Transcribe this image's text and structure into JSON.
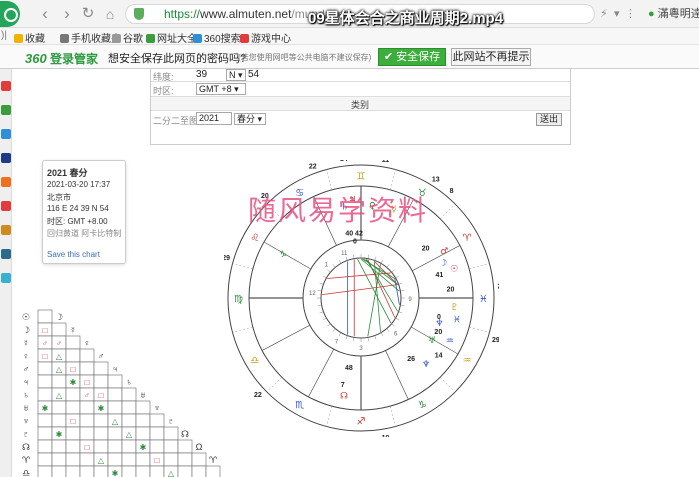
{
  "browser": {
    "url_proto": "https://",
    "url_domain": "www.almuten.net",
    "url_rest": "/mundane",
    "video_title": "09星体会合之商业周期2.mp4",
    "user_label": "滿粵明逹"
  },
  "bookmarks": [
    {
      "label": "收藏",
      "color": "#f0b400"
    },
    {
      "label": "手机收藏夹",
      "color": "#777777"
    },
    {
      "label": "谷歌",
      "color": "#999999"
    },
    {
      "label": "网址大全",
      "color": "#3a9c3a"
    },
    {
      "label": "360搜索",
      "color": "#2e8fd6"
    },
    {
      "label": "游戏中心",
      "color": "#e23b3b"
    }
  ],
  "password_bar": {
    "brand_num": "360",
    "brand_text": "登录管家",
    "question": "想安全保存此网页的密码吗?",
    "note": "(若您使用网吧等公共电脑不建议保存)",
    "save_label": "安全保存",
    "never_label": "此网站不再提示"
  },
  "form": {
    "lat_label": "纬度:",
    "lat_deg": "39",
    "lat_dir": "N",
    "lat_min": "54",
    "tz_label": "时区:",
    "tz_value": "GMT +8",
    "category_header": "类别",
    "year_label": "二分二至图:",
    "year_value": "2021",
    "season_value": "春分",
    "submit_label": "送出"
  },
  "card": {
    "title": "2021 春分",
    "datetime": "2021-03-20 17:37",
    "place": "北京市",
    "coords": "116 E 24  39 N 54",
    "tz": "时区: GMT +8.00",
    "system": "回归黄道 阿卡比特制",
    "save_link": "Save this chart"
  },
  "watermark": "随风易学资料",
  "chart": {
    "outer_numbers": [
      {
        "t": "29",
        "a": 163
      },
      {
        "t": "20",
        "a": 133
      },
      {
        "t": "22",
        "a": 110
      },
      {
        "t": "14",
        "a": 97
      },
      {
        "t": "11",
        "a": 80
      },
      {
        "t": "13",
        "a": 58
      },
      {
        "t": "8",
        "a": 50
      },
      {
        "t": "21",
        "a": 5
      },
      {
        "t": "29",
        "a": -17
      },
      {
        "t": "19",
        "a": -80
      },
      {
        "t": "22",
        "a": -137
      },
      {
        "t": "21",
        "a": 178
      },
      {
        "t": "4",
        "a": 88
      }
    ],
    "inner_numbers": [
      {
        "t": "12",
        "a": 173
      },
      {
        "t": "3",
        "a": -90
      },
      {
        "t": "9",
        "a": 0
      },
      {
        "t": "6",
        "a": -45
      },
      {
        "t": "1",
        "a": 135
      },
      {
        "t": "11",
        "a": 110
      },
      {
        "t": "7",
        "a": -120
      }
    ],
    "planet_labels": [
      {
        "t": "20",
        "a": 38,
        "r": 82
      },
      {
        "t": "41",
        "a": 17,
        "r": 82
      },
      {
        "t": "20",
        "a": 6,
        "r": 90
      },
      {
        "t": "0",
        "a": -13,
        "r": 80
      },
      {
        "t": "20",
        "a": -23,
        "r": 84
      },
      {
        "t": "26",
        "a": -50,
        "r": 78
      },
      {
        "t": "14",
        "a": -36,
        "r": 96
      },
      {
        "t": "48",
        "a": -100,
        "r": 70
      },
      {
        "t": "7",
        "a": -102,
        "r": 88
      },
      {
        "t": "40 42",
        "a": 96,
        "r": 66
      },
      {
        "t": "0",
        "a": 96,
        "r": 58
      }
    ]
  },
  "grid": {
    "rows": 13
  }
}
